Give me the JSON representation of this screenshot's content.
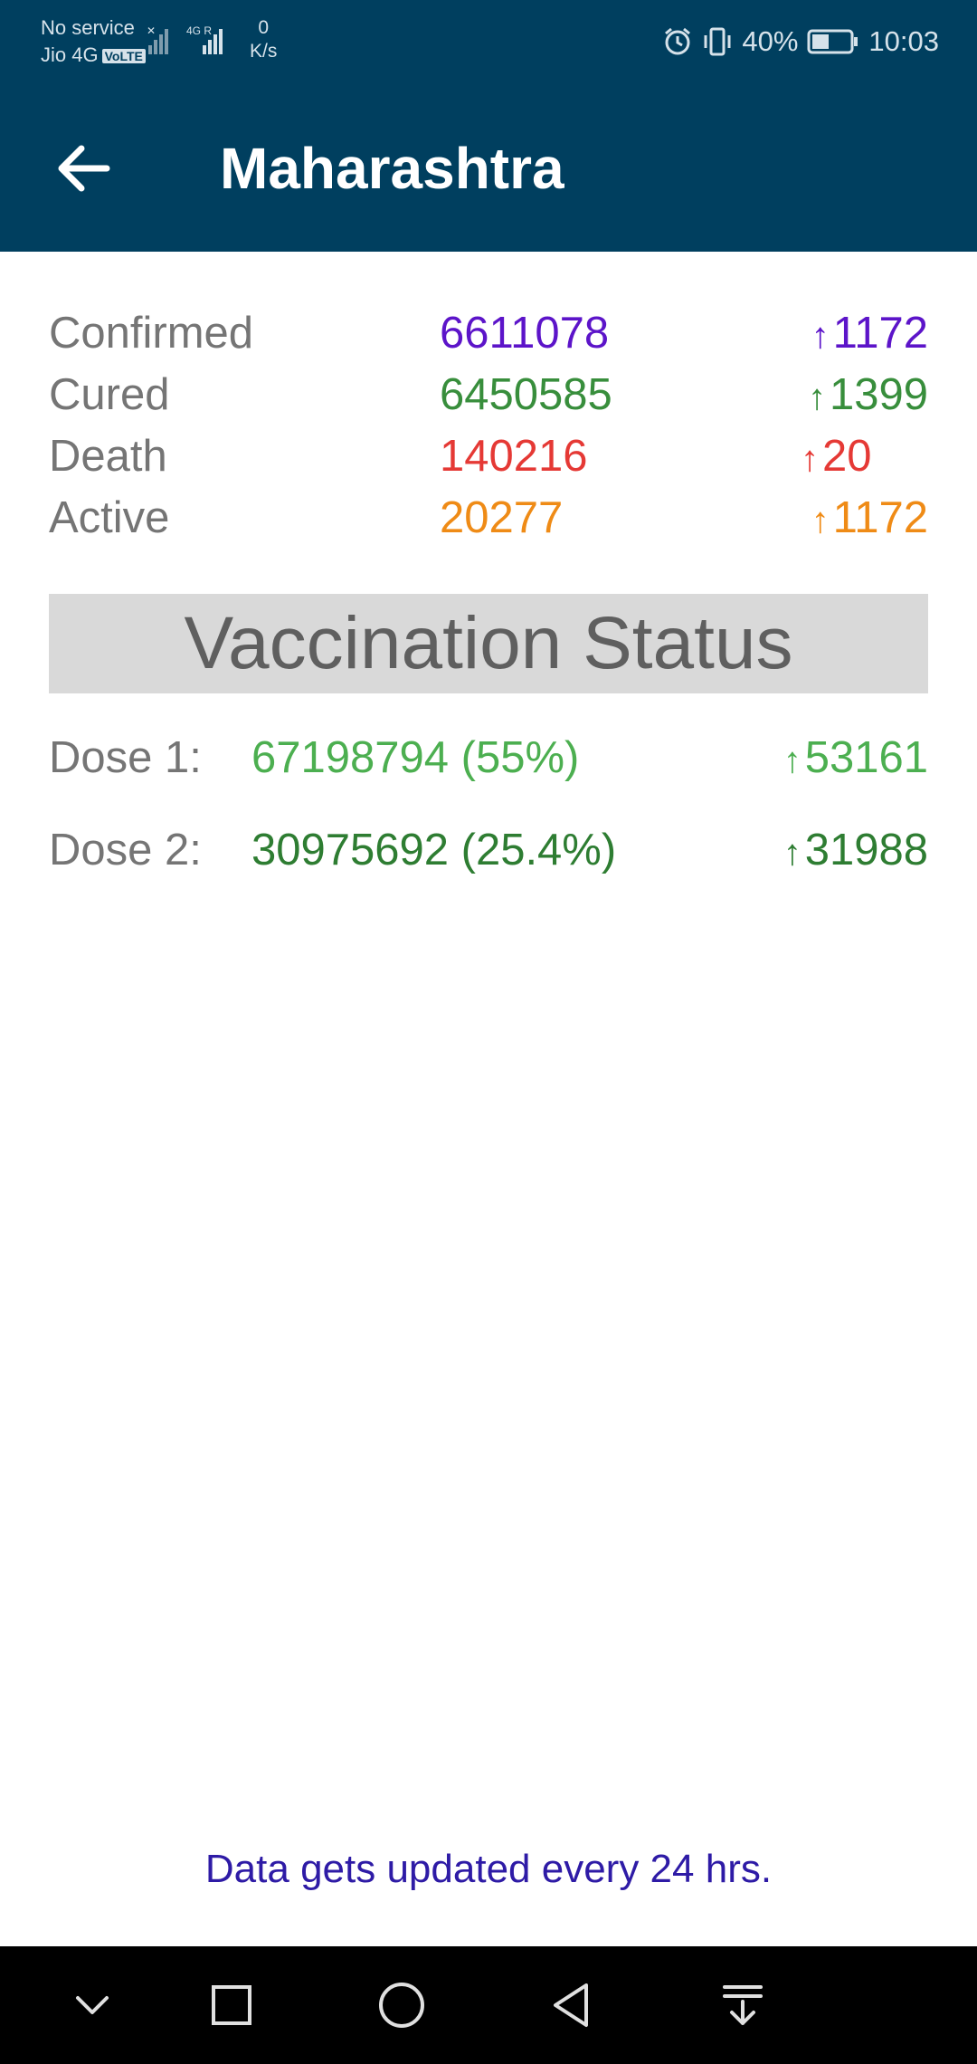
{
  "status_bar": {
    "carrier_line1": "No service",
    "carrier_line2": "Jio 4G",
    "volte": "VoLTE",
    "network_type": "4G",
    "speed_value": "0",
    "speed_unit": "K/s",
    "battery": "40%",
    "time": "10:03"
  },
  "header": {
    "title": "Maharashtra"
  },
  "stats": [
    {
      "label": "Confirmed",
      "value": "6611078",
      "delta": "1172",
      "color": "#5c14c9"
    },
    {
      "label": "Cured",
      "value": "6450585",
      "delta": "1399",
      "color": "#388e3c"
    },
    {
      "label": "Death",
      "value": "140216",
      "delta": "20",
      "color": "#e53935"
    },
    {
      "label": "Active",
      "value": "20277",
      "delta": "1172",
      "color": "#ef8b16"
    }
  ],
  "vaccination": {
    "title": "Vaccination Status",
    "doses": [
      {
        "label": "Dose 1:",
        "value": "67198794 (55%)",
        "delta": "53161",
        "color": "#4caf50"
      },
      {
        "label": "Dose 2:",
        "value": "30975692 (25.4%)",
        "delta": "31988",
        "color": "#2e7d32"
      }
    ]
  },
  "footer": {
    "note": "Data gets updated every 24 hrs."
  },
  "icons": {
    "up_arrow": "↑"
  },
  "colors": {
    "app_bar": "#003f5f",
    "vaccination_header_bg": "#d9d9d9",
    "footnote": "#2e1ba6"
  }
}
